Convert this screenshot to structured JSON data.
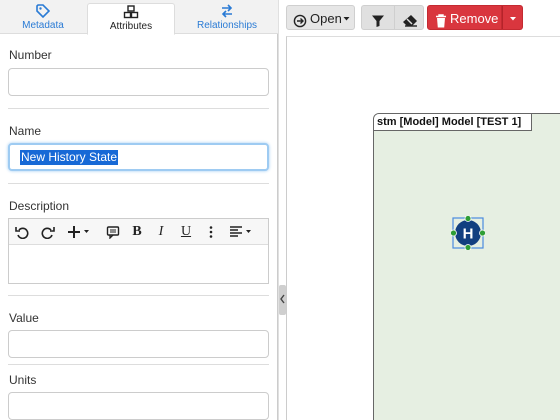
{
  "tabs": [
    {
      "label": "Metadata",
      "icon": "tag-icon"
    },
    {
      "label": "Attributes",
      "icon": "cubes-icon"
    },
    {
      "label": "Relationships",
      "icon": "exchange-icon"
    }
  ],
  "fields": {
    "number": {
      "label": "Number",
      "value": ""
    },
    "name": {
      "label": "Name",
      "value": "New History State"
    },
    "description": {
      "label": "Description",
      "value": ""
    },
    "value": {
      "label": "Value",
      "value": ""
    },
    "units": {
      "label": "Units",
      "value": ""
    }
  },
  "editor_toolbar": [
    "undo-icon",
    "redo-icon",
    "insert-plus-icon",
    "comment-icon",
    "bold-icon",
    "italic-icon",
    "underline-icon",
    "more-vertical-icon",
    "align-left-icon"
  ],
  "toolbar": {
    "open_label": "Open",
    "remove_label": "Remove"
  },
  "diagram": {
    "frame_label": "stm [Model] Model [TEST 1]",
    "node_letter": "H"
  },
  "colors": {
    "link_blue": "#2a7bd5",
    "selection_blue": "#1769d6",
    "remove_red": "#d9363e",
    "diagram_bg": "#e6efe2",
    "node_blue": "#123f80",
    "handle_green": "#2e9e35"
  }
}
